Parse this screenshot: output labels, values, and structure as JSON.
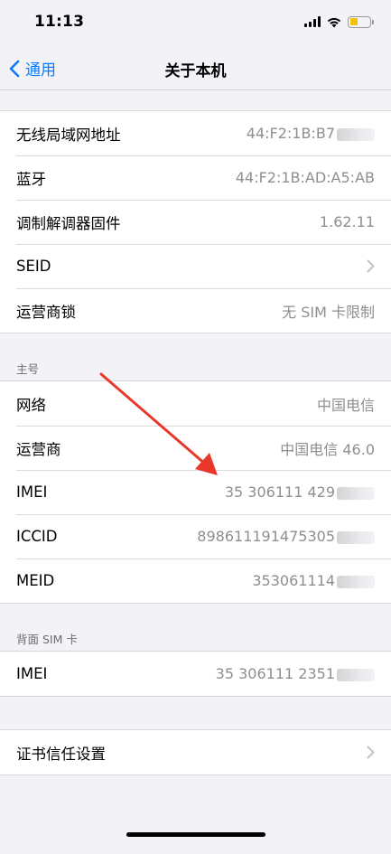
{
  "status_bar": {
    "time": "11:13"
  },
  "nav": {
    "back_label": "通用",
    "title": "关于本机"
  },
  "group1": [
    {
      "label": "无线局域网地址",
      "value": "44:F2:1B:B7"
    },
    {
      "label": "蓝牙",
      "value": "44:F2:1B:AD:A5:AB"
    },
    {
      "label": "调制解调器固件",
      "value": "1.62.11"
    },
    {
      "label": "SEID",
      "value": ""
    },
    {
      "label": "运营商锁",
      "value": "无 SIM 卡限制"
    }
  ],
  "section_primary": {
    "header": "主号"
  },
  "group2": [
    {
      "label": "网络",
      "value": "中国电信"
    },
    {
      "label": "运营商",
      "value": "中国电信 46.0"
    },
    {
      "label": "IMEI",
      "value": "35 306111 429"
    },
    {
      "label": "ICCID",
      "value": "898611191475305"
    },
    {
      "label": "MEID",
      "value": "353061114"
    }
  ],
  "section_back_sim": {
    "header": "背面 SIM 卡"
  },
  "group3": [
    {
      "label": "IMEI",
      "value": "35 306111 2351"
    }
  ],
  "group4": [
    {
      "label": "证书信任设置",
      "value": ""
    }
  ],
  "colors": {
    "accent": "#0a7cff",
    "arrow": "#e8382c",
    "battery": "#f5c20b"
  }
}
